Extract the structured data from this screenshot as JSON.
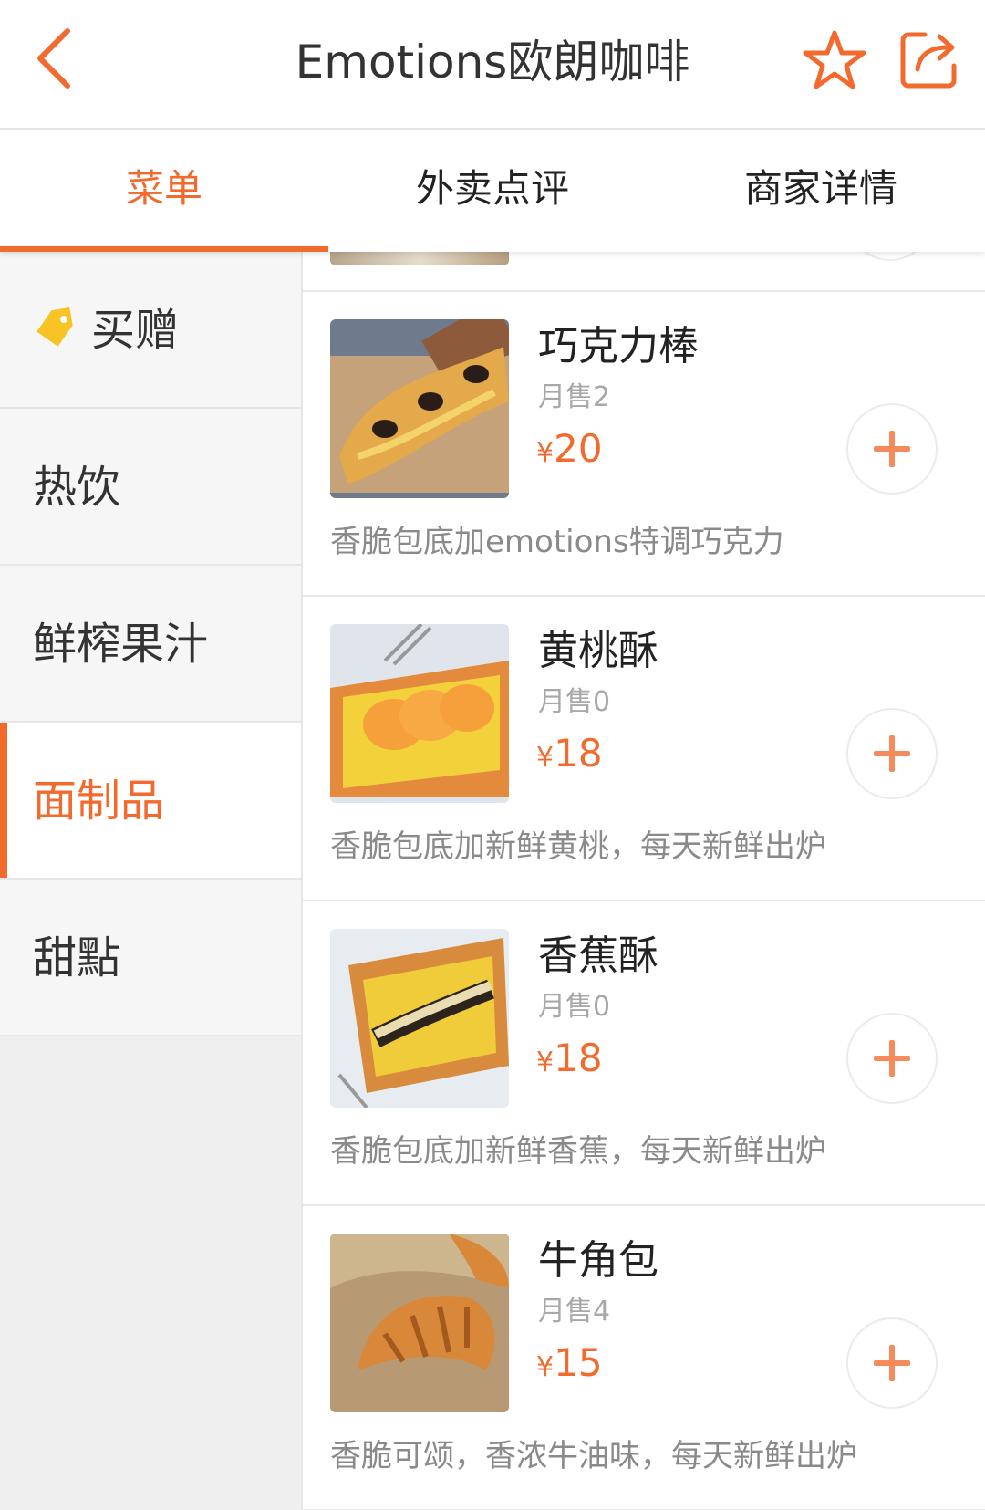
{
  "header": {
    "title": "Emotions欧朗咖啡"
  },
  "tabs": [
    {
      "label": "菜单",
      "active": true
    },
    {
      "label": "外卖点评",
      "active": false
    },
    {
      "label": "商家详情",
      "active": false
    }
  ],
  "sidebar": {
    "items": [
      {
        "label": "买赠",
        "icon": "tag-icon"
      },
      {
        "label": "热饮"
      },
      {
        "label": "鲜榨果汁"
      },
      {
        "label": "面制品",
        "active": true
      },
      {
        "label": "甜點"
      }
    ]
  },
  "menu": {
    "currency": "¥",
    "sales_prefix": "月售",
    "items": [
      {
        "name": "巧克力棒",
        "sales": "月售2",
        "price": "20",
        "desc": "香脆包底加emotions特调巧克力"
      },
      {
        "name": "黄桃酥",
        "sales": "月售0",
        "price": "18",
        "desc": "香脆包底加新鲜黄桃，每天新鲜出炉"
      },
      {
        "name": "香蕉酥",
        "sales": "月售0",
        "price": "18",
        "desc": "香脆包底加新鲜香蕉，每天新鲜出炉"
      },
      {
        "name": "牛角包",
        "sales": "月售4",
        "price": "15",
        "desc": "香脆可颂，香浓牛油味，每天新鲜出炉"
      }
    ]
  },
  "colors": {
    "accent": "#f26a2d",
    "muted": "#a8a8a8",
    "desc": "#8a8a8a"
  }
}
